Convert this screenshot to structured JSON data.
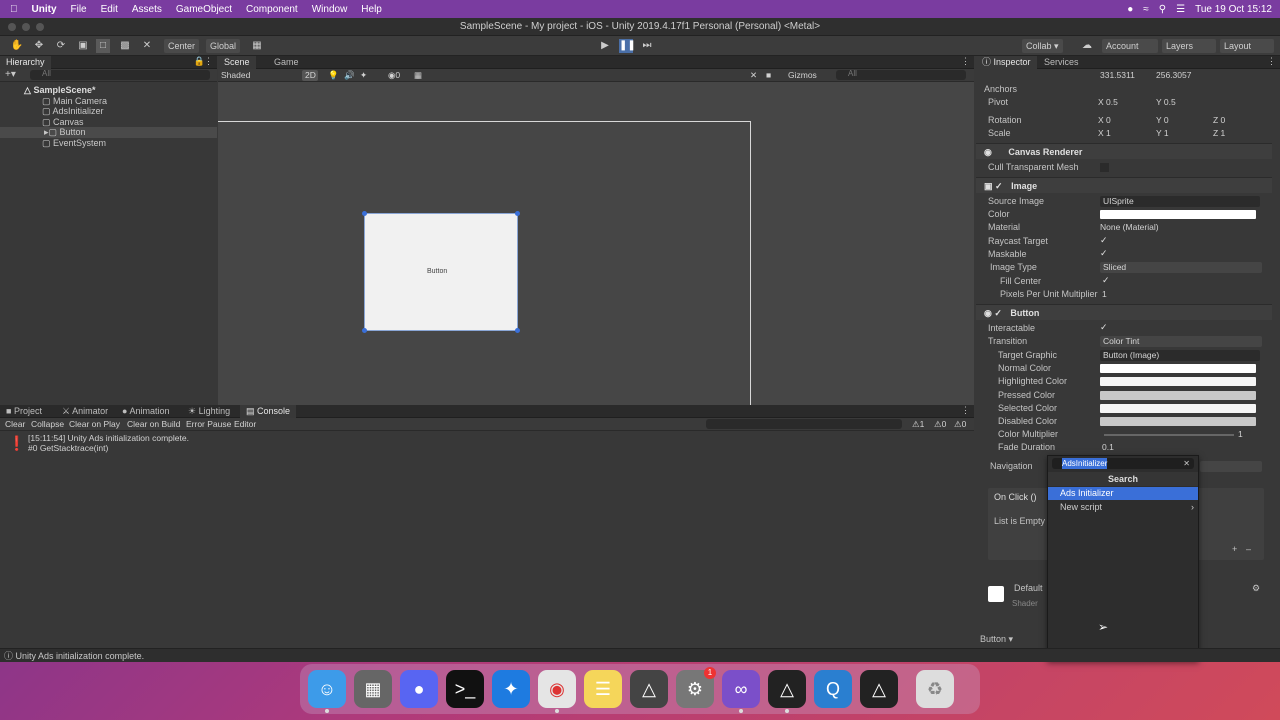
{
  "menubar": {
    "app": "Unity",
    "items": [
      "File",
      "Edit",
      "Assets",
      "GameObject",
      "Component",
      "Window",
      "Help"
    ],
    "datetime": "Tue 19 Oct  15:12"
  },
  "window": {
    "title": "SampleScene - My project - iOS - Unity 2019.4.17f1 Personal (Personal) <Metal>"
  },
  "toolbar": {
    "center": "Center",
    "global": "Global",
    "collab": "Collab ▾",
    "account": "Account",
    "layers": "Layers",
    "layout": "Layout"
  },
  "hierarchy": {
    "tab": "Hierarchy",
    "search_placeholder": "All",
    "scene": "SampleScene*",
    "items": [
      "Main Camera",
      "AdsInitializer",
      "Canvas",
      "Button",
      "EventSystem"
    ]
  },
  "scene": {
    "tabs": [
      "Scene",
      "Game"
    ],
    "shading": "Shaded",
    "mode2d": "2D",
    "layers_count": "0",
    "gizmos": "Gizmos",
    "search_placeholder": "All",
    "button_text": "Button"
  },
  "console": {
    "tabs": [
      "Project",
      "Animator",
      "Animation",
      "Lighting",
      "Console"
    ],
    "buttons": [
      "Clear",
      "Collapse",
      "Clear on Play",
      "Clear on Build",
      "Error Pause",
      "Editor"
    ],
    "counts": [
      "1",
      "0",
      "0"
    ],
    "log_line1": "[15:11:54] Unity Ads initialization complete.",
    "log_line2": "#0 GetStacktrace(int)"
  },
  "inspector": {
    "tabs": [
      "Inspector",
      "Services"
    ],
    "top_values": [
      "331.5311",
      "256.3057"
    ],
    "anchors": "Anchors",
    "pivot": "Pivot",
    "pivot_x": "X 0.5",
    "pivot_y": "Y 0.5",
    "rotation": "Rotation",
    "rot_x": "X 0",
    "rot_y": "Y 0",
    "rot_z": "Z 0",
    "scale": "Scale",
    "scale_x": "X 1",
    "scale_y": "Y 1",
    "scale_z": "Z 1",
    "canvas_renderer": "Canvas Renderer",
    "cull": "Cull Transparent Mesh",
    "image": "Image",
    "source_image": "Source Image",
    "source_image_val": "UISprite",
    "color": "Color",
    "material": "Material",
    "material_val": "None (Material)",
    "raycast": "Raycast Target",
    "maskable": "Maskable",
    "image_type": "Image Type",
    "image_type_val": "Sliced",
    "fill_center": "Fill Center",
    "ppu": "Pixels Per Unit Multiplier",
    "ppu_val": "1",
    "button": "Button",
    "interactable": "Interactable",
    "transition": "Transition",
    "transition_val": "Color Tint",
    "target_graphic": "Target Graphic",
    "target_graphic_val": "Button (Image)",
    "normal": "Normal Color",
    "highlighted": "Highlighted Color",
    "pressed": "Pressed Color",
    "selected": "Selected Color",
    "disabled": "Disabled Color",
    "multiplier": "Color Multiplier",
    "multiplier_val": "1",
    "fade": "Fade Duration",
    "fade_val": "0.1",
    "navigation": "Navigation",
    "onclick": "On Click ()",
    "list_empty": "List is Empty",
    "material_name": "Default",
    "shader": "Shader",
    "footer": "Button ▾"
  },
  "popup": {
    "search_value": "AdsInitializer",
    "header": "Search",
    "items": [
      "Ads Initializer",
      "New script"
    ]
  },
  "status": "Unity Ads initialization complete.",
  "dock": {
    "items": [
      "finder-icon",
      "launchpad-icon",
      "discord-icon",
      "terminal-icon",
      "safari-icon",
      "chrome-icon",
      "notes-icon",
      "unity-hub-icon",
      "system-preferences-icon",
      "visual-studio-icon",
      "unity-icon",
      "quicktime-icon",
      "unity-icon-2",
      "trash-icon"
    ],
    "badge": "1"
  },
  "colors": {
    "accent": "#3a6fd8",
    "menubar": "#7a3ca0",
    "panel": "#383838"
  }
}
